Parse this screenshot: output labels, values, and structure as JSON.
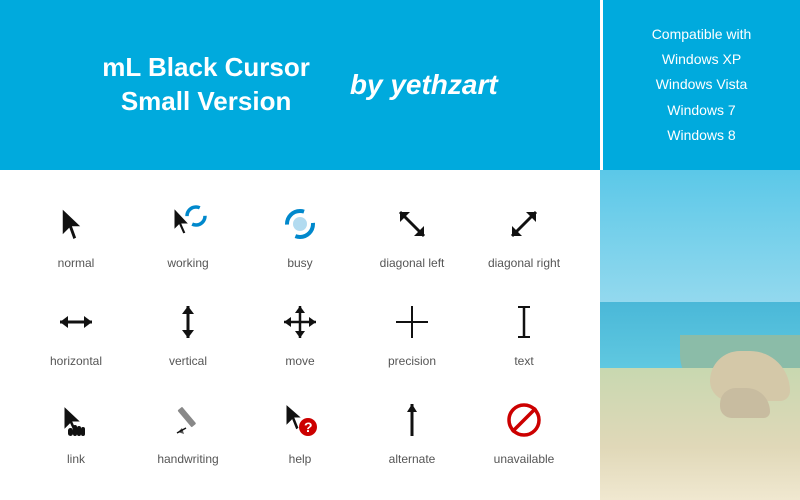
{
  "header": {
    "title_line1": "mL Black Cursor",
    "title_line2": "Small Version",
    "author_label": "by yethzart",
    "compat_title": "Compatible with",
    "compat_items": [
      "Windows XP",
      "Windows Vista",
      "Windows 7",
      "Windows 8"
    ]
  },
  "cursors": [
    {
      "id": "normal",
      "label": "normal"
    },
    {
      "id": "working",
      "label": "working"
    },
    {
      "id": "busy",
      "label": "busy"
    },
    {
      "id": "diagonal-left",
      "label": "diagonal left"
    },
    {
      "id": "diagonal-right",
      "label": "diagonal right"
    },
    {
      "id": "horizontal",
      "label": "horizontal"
    },
    {
      "id": "vertical",
      "label": "vertical"
    },
    {
      "id": "move",
      "label": "move"
    },
    {
      "id": "precision",
      "label": "precision"
    },
    {
      "id": "text",
      "label": "text"
    },
    {
      "id": "link",
      "label": "link"
    },
    {
      "id": "handwriting",
      "label": "handwriting"
    },
    {
      "id": "help",
      "label": "help"
    },
    {
      "id": "alternate",
      "label": "alternate"
    },
    {
      "id": "unavailable",
      "label": "unavailable"
    }
  ],
  "colors": {
    "brand_blue": "#00aadd",
    "text_white": "#ffffff",
    "text_gray": "#555555",
    "icon_black": "#111111",
    "icon_red": "#cc0000",
    "icon_blue": "#0066cc"
  }
}
